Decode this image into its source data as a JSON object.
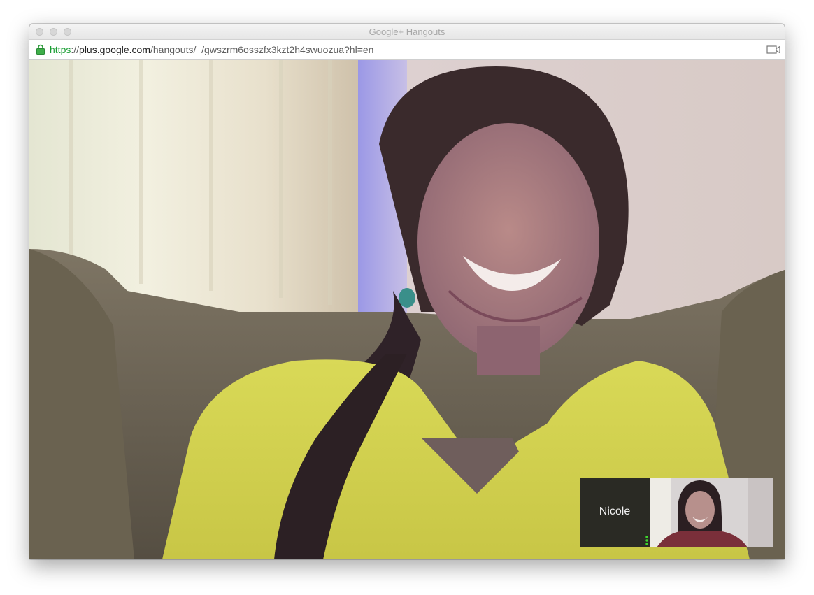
{
  "window": {
    "title": "Google+ Hangouts"
  },
  "addressbar": {
    "url_scheme": "https",
    "url_separator": "://",
    "url_host": "plus.google.com",
    "url_path": "/hangouts/_/gwszrm6osszfx3kzt2h4swuozua?hl=en"
  },
  "participant": {
    "name": "Nicole"
  },
  "icons": {
    "lock": "lock-icon",
    "camera": "video-camera-icon",
    "audio": "audio-level-icon"
  },
  "colors": {
    "secure_scheme": "#1a9e34",
    "audio_level": "#3dd62b"
  }
}
